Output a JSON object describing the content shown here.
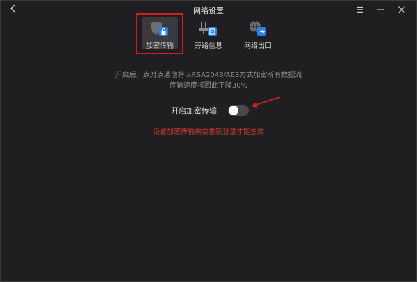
{
  "window": {
    "title": "网络设置"
  },
  "tabs": [
    {
      "label": "加密传输",
      "icon": "lock-shield-icon",
      "active": true
    },
    {
      "label": "旁路信息",
      "icon": "bypass-network-icon",
      "active": false
    },
    {
      "label": "网络出口",
      "icon": "network-exit-icon",
      "active": false
    }
  ],
  "content": {
    "description_line1": "开启后，点对点通信将以RSA2048/AES方式加密所有数据流",
    "description_line2": "传输速度将因此下降30%",
    "toggle_label": "开启加密传输",
    "toggle_on": false,
    "warning": "设置加密传输需要重新登录才能生效"
  },
  "colors": {
    "background": "#1f1f21",
    "accent_blue": "#2b7de9",
    "warning_red": "#d13b2f",
    "highlight_red": "#d11f1f"
  }
}
